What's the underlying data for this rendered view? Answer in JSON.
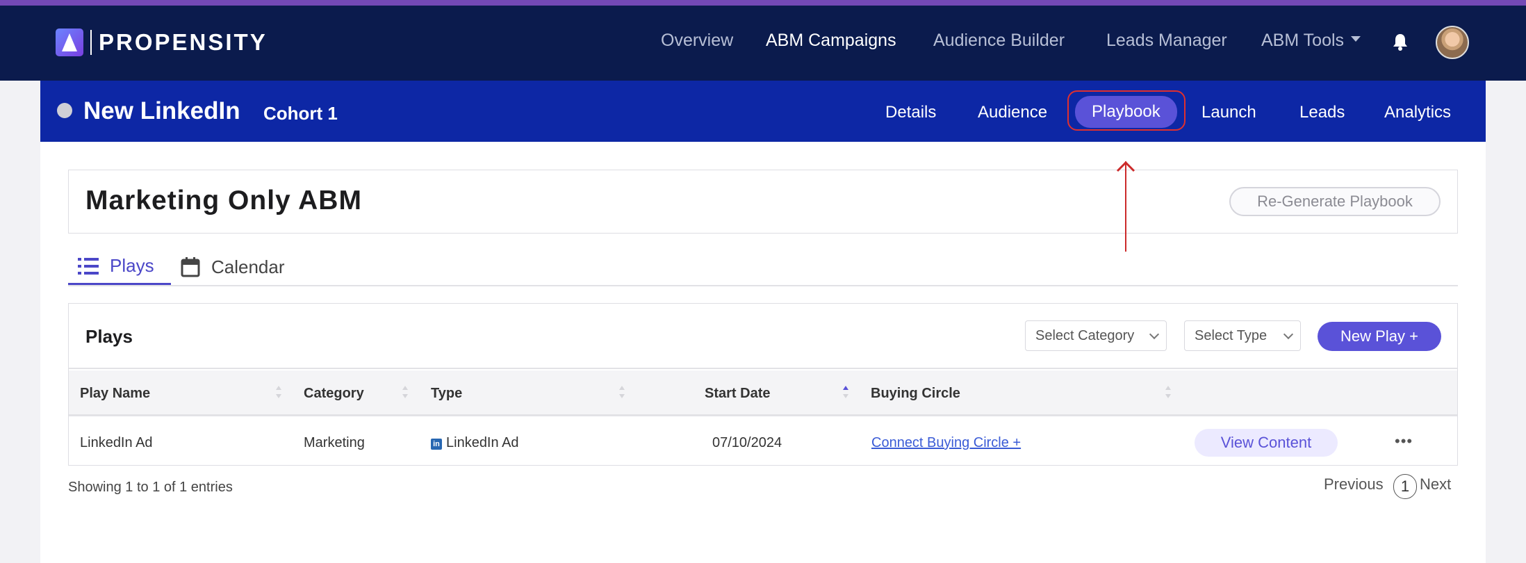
{
  "brand": {
    "name": "PROPENSITY"
  },
  "nav": {
    "items": [
      {
        "label": "Overview"
      },
      {
        "label": "ABM Campaigns"
      },
      {
        "label": "Audience Builder"
      },
      {
        "label": "Leads Manager"
      },
      {
        "label": "ABM Tools"
      }
    ],
    "active": "ABM Campaigns"
  },
  "campaign": {
    "name": "New LinkedIn",
    "cohort": "Cohort 1",
    "tabs": [
      {
        "label": "Details"
      },
      {
        "label": "Audience"
      },
      {
        "label": "Playbook"
      },
      {
        "label": "Launch"
      },
      {
        "label": "Leads"
      },
      {
        "label": "Analytics"
      }
    ],
    "active_tab": "Playbook"
  },
  "playbook": {
    "title": "Marketing Only ABM",
    "regenerate_label": "Re-Generate Playbook"
  },
  "subtabs": [
    {
      "label": "Plays"
    },
    {
      "label": "Calendar"
    }
  ],
  "plays": {
    "title": "Plays",
    "category_placeholder": "Select Category",
    "type_placeholder": "Select Type",
    "new_play_label": "New Play +",
    "columns": [
      "Play Name",
      "Category",
      "Type",
      "Start Date",
      "Buying Circle"
    ],
    "rows": [
      {
        "play_name": "LinkedIn Ad",
        "category": "Marketing",
        "type": "LinkedIn Ad",
        "start_date": "07/10/2024",
        "buying_circle": "Connect Buying Circle +",
        "action": "View Content",
        "more": "•••"
      }
    ],
    "showing": "Showing 1 to 1 of 1 entries",
    "pagination": {
      "previous": "Previous",
      "current": "1",
      "next": "Next"
    }
  },
  "colors": {
    "nav_bg": "#0b1b4d",
    "campaign_bar": "#0d27a5",
    "accent": "#5a52d8",
    "annotation": "#cc2a2a"
  },
  "icons": [
    "bell-icon",
    "avatar",
    "list-icon",
    "calendar-icon",
    "linkedin-icon",
    "more-icon"
  ]
}
